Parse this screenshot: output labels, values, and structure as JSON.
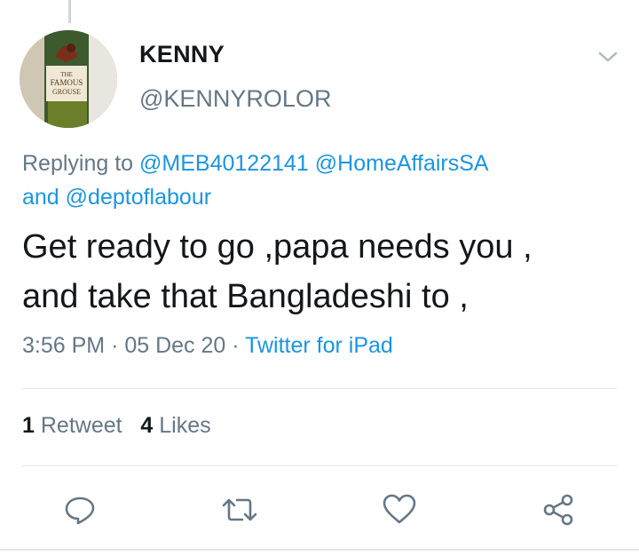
{
  "tweet": {
    "author_name": "KENNY",
    "author_handle": "@KENNYROLOR",
    "replying_prefix": "Replying to ",
    "mentions": [
      "@MEB40122141",
      "@HomeAffairsSA",
      "@deptoflabour"
    ],
    "mention_joiner": "and ",
    "text_line1": "Get ready to go ,papa needs you ,",
    "text_line2": "and take that Bangladeshi to ,",
    "time": "3:56 PM",
    "date": "05 Dec 20",
    "separator": "·",
    "source": "Twitter for iPad"
  },
  "stats": {
    "retweet_count": "1",
    "retweet_label": "Retweet",
    "likes_count": "4",
    "likes_label": "Likes"
  },
  "avatar_label": "THE FAMOUS GROUSE",
  "colors": {
    "accent": "#1b95e0",
    "muted": "#657786",
    "text": "#14171a",
    "divider": "#e1e8ed"
  },
  "icons": [
    "chevron-down-icon",
    "reply-icon",
    "retweet-icon",
    "like-icon",
    "share-icon"
  ]
}
